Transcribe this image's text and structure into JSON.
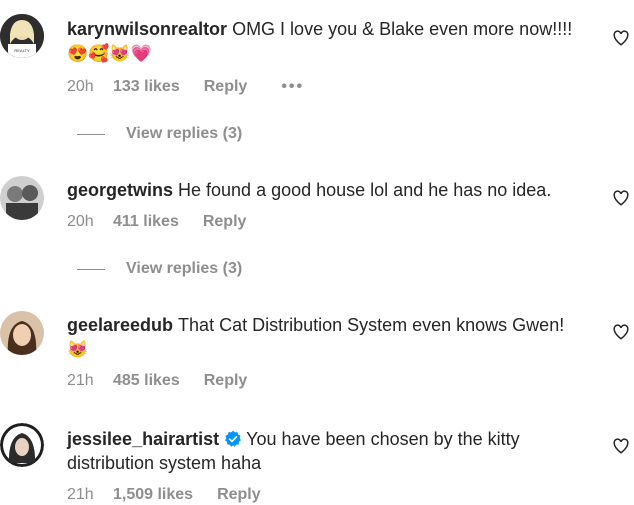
{
  "comments": [
    {
      "username": "karynwilsonrealtor",
      "text": "OMG I love you & Blake even more now!!!!",
      "emojis": "😍🥰😻💗",
      "time": "20h",
      "likes": "133 likes",
      "reply": "Reply",
      "more": "•••",
      "view_replies": "View replies (3)"
    },
    {
      "username": "georgetwins",
      "text": "He found a good house lol and he has no idea.",
      "time": "20h",
      "likes": "411 likes",
      "reply": "Reply",
      "view_replies": "View replies (3)"
    },
    {
      "username": "geelareedub",
      "text": "That Cat Distribution System even knows Gwen!",
      "emojis": "😻",
      "time": "21h",
      "likes": "485 likes",
      "reply": "Reply"
    },
    {
      "username": "jessilee_hairartist",
      "verified": true,
      "text": "You have been chosen by the kitty distribution system haha",
      "time": "21h",
      "likes": "1,509 likes",
      "reply": "Reply"
    }
  ],
  "icons": {
    "like": "heart-outline-icon",
    "verified": "verified-badge-icon",
    "more": "more-options-icon"
  },
  "colors": {
    "text": "#262626",
    "secondary": "#8e8e8e",
    "verified": "#0095f6"
  }
}
